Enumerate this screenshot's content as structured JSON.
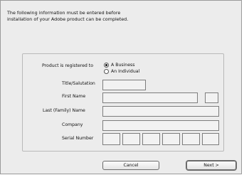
{
  "intro": {
    "line1": "The following information must be entered before",
    "line2": "installation of your Adobe product can be completed."
  },
  "form": {
    "registered_label": "Product is registered to",
    "registration_options": [
      {
        "label": "A Business",
        "selected": true
      },
      {
        "label": "An Individual",
        "selected": false
      }
    ],
    "title_label": "Title/Salutation",
    "first_name_label": "First Name",
    "last_name_label": "Last (Family) Name",
    "company_label": "Company",
    "serial_label": "Serial Number",
    "title_value": "",
    "first_name_value": "",
    "middle_initial_value": "",
    "last_name_value": "",
    "company_value": "",
    "serial_segments": [
      "",
      "",
      "",
      "",
      "",
      ""
    ]
  },
  "buttons": {
    "cancel": "Cancel",
    "next": "Next >"
  }
}
